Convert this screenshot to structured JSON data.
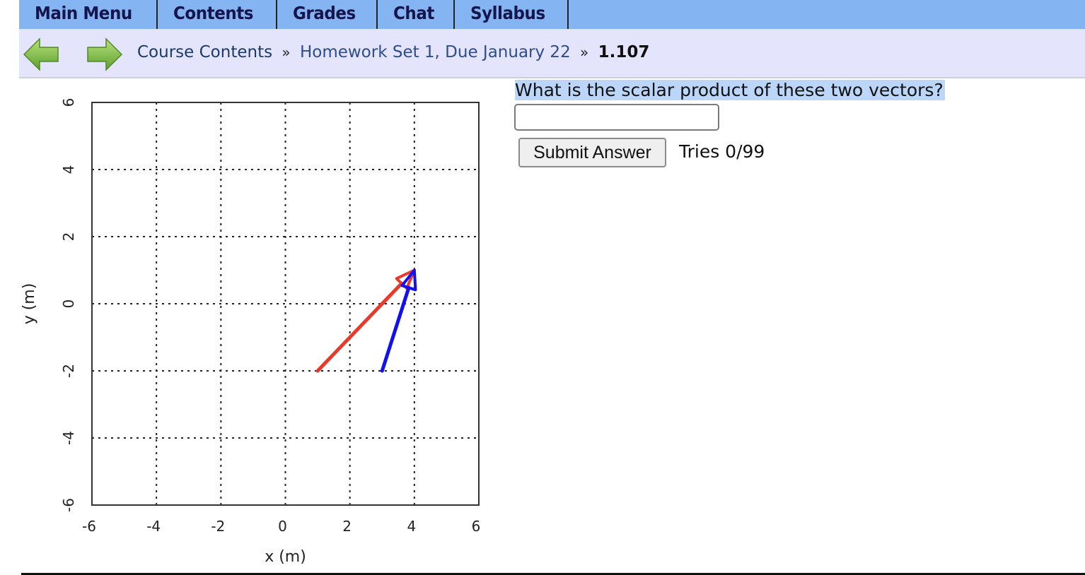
{
  "nav": {
    "tabs": [
      {
        "label": "Main Menu"
      },
      {
        "label": "Contents"
      },
      {
        "label": "Grades"
      },
      {
        "label": "Chat"
      },
      {
        "label": "Syllabus"
      }
    ],
    "colors": {
      "nav_bg": "#85b4f2",
      "crumb_bg": "#e4e4fc"
    }
  },
  "breadcrumb": {
    "back_icon": "green-left-arrow",
    "forward_icon": "green-right-arrow",
    "items": [
      {
        "label": "Course Contents"
      },
      {
        "label": "Homework Set 1, Due January 22"
      }
    ],
    "separator": "»",
    "current": "1.107"
  },
  "problem": {
    "question": "What is the scalar product of these two vectors?",
    "answer_value": "",
    "answer_placeholder": "",
    "submit_label": "Submit Answer",
    "tries": "Tries 0/99"
  },
  "chart_data": {
    "type": "line",
    "title": "",
    "xlabel": "x (m)",
    "ylabel": "y (m)",
    "xlim": [
      -6,
      6
    ],
    "ylim": [
      -6,
      6
    ],
    "xticks": [
      "-6",
      "-4",
      "-2",
      "0",
      "2",
      "4",
      "6"
    ],
    "yticks": [
      "-6",
      "-4",
      "-2",
      "0",
      "2",
      "4",
      "6"
    ],
    "grid": true,
    "series": [
      {
        "name": "vector-red",
        "color": "#e8392b",
        "from": [
          1,
          -2
        ],
        "to": [
          4,
          1
        ]
      },
      {
        "name": "vector-blue",
        "color": "#1010f0",
        "from": [
          3,
          -2
        ],
        "to": [
          4,
          1
        ]
      }
    ]
  }
}
